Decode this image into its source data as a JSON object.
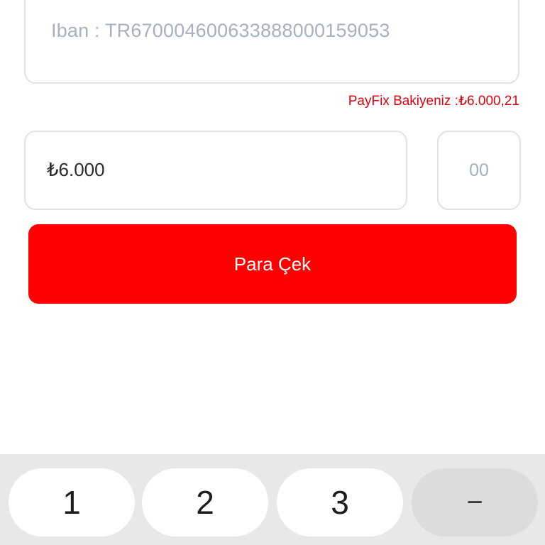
{
  "form": {
    "iban_text": "Iban : TR670004600633888000159053",
    "balance_text": "PayFix Bakiyeniz :₺6.000,21",
    "amount_value": "₺6.000",
    "cents_placeholder": "00",
    "withdraw_label": "Para Çek"
  },
  "keyboard": {
    "keys": [
      "1",
      "2",
      "3",
      "−"
    ]
  },
  "colors": {
    "accent": "#ff0000",
    "balance_text": "#e0000f",
    "placeholder": "#a8b0bf",
    "border": "#e3e3e3",
    "keyboard_bg": "#e8e8e8"
  }
}
